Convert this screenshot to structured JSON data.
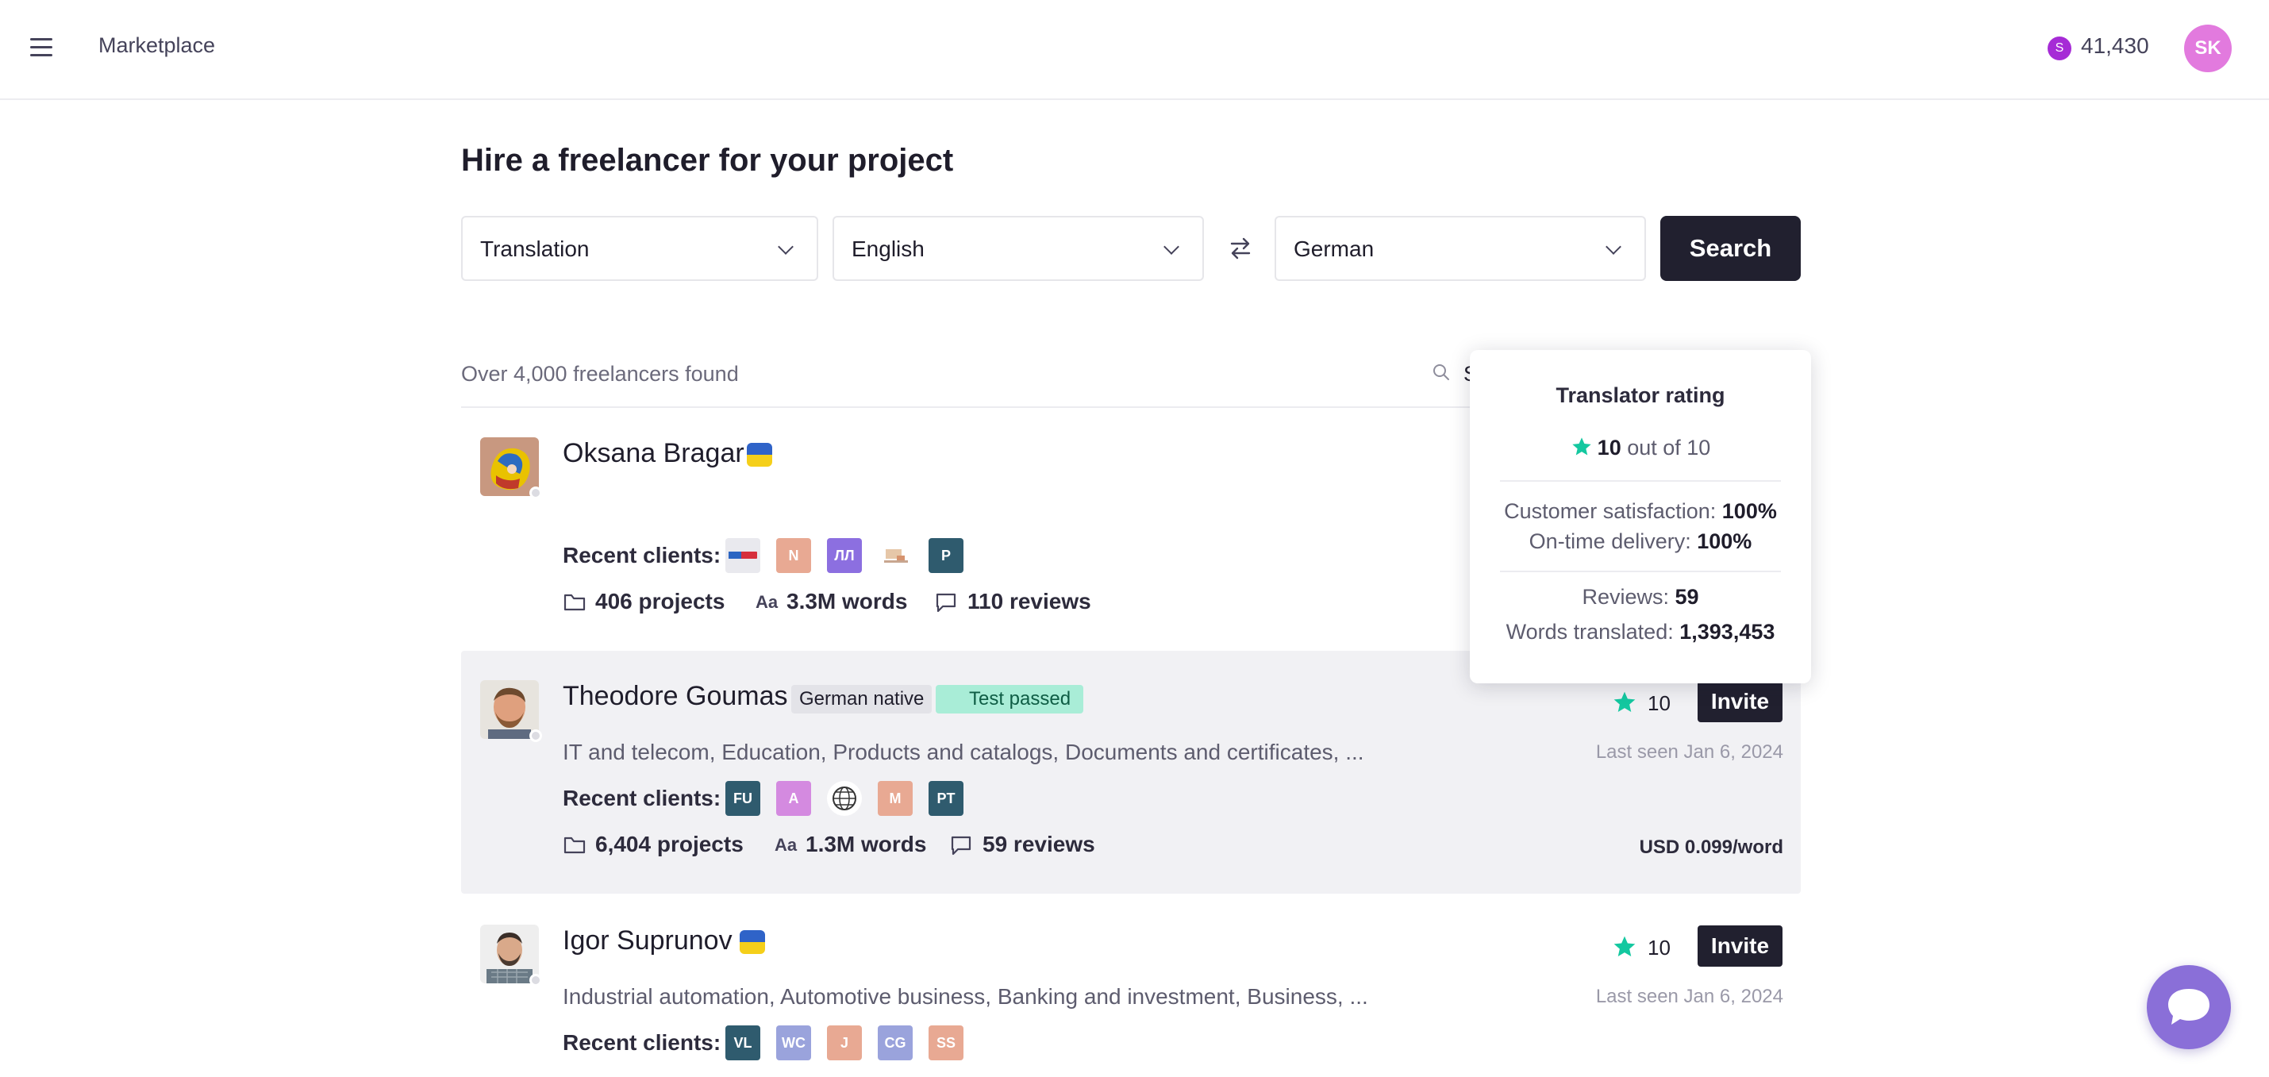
{
  "header": {
    "title": "Marketplace",
    "balance": "41,430",
    "coin_symbol": "S",
    "user_initials": "SK"
  },
  "page_title": "Hire a freelancer for your project",
  "search": {
    "service": "Translation",
    "source_language": "English",
    "target_language": "German",
    "button_label": "Search"
  },
  "results": {
    "count_text": "Over 4,000 freelancers found",
    "search_label": "S"
  },
  "freelancers": [
    {
      "name": "Oksana Bragar",
      "flag": "ua",
      "clients_label": "Recent clients:",
      "clients": [
        "",
        "N",
        "ЛЛ",
        "",
        "P"
      ],
      "projects": "406 projects",
      "words": "3.3M words",
      "reviews": "110 reviews"
    },
    {
      "name": "Theodore Goumas",
      "badge_native": "German native",
      "badge_test": "Test passed",
      "specializations": "IT and telecom, Education, Products and catalogs, Documents and certificates, ...",
      "clients_label": "Recent clients:",
      "clients": [
        "FU",
        "A",
        "",
        "M",
        "PT"
      ],
      "projects": "6,404 projects",
      "words": "1.3M words",
      "reviews": "59 reviews",
      "rating": "10",
      "invite": "Invite",
      "last_seen": "Last seen Jan 6, 2024",
      "rate": "USD 0.099/word"
    },
    {
      "name": "Igor Suprunov",
      "flag": "ua",
      "specializations": "Industrial automation, Automotive business, Banking and investment, Business, ...",
      "clients_label": "Recent clients:",
      "clients": [
        "VL",
        "WC",
        "J",
        "CG",
        "SS"
      ],
      "rating": "10",
      "invite": "Invite",
      "last_seen": "Last seen Jan 6, 2024"
    }
  ],
  "words_icon": "Aa",
  "popover": {
    "title": "Translator rating",
    "score": "10",
    "score_suffix": "out of 10",
    "satisfaction_label": "Customer satisfaction:",
    "satisfaction_value": "100%",
    "ontime_label": "On-time delivery:",
    "ontime_value": "100%",
    "reviews_label": "Reviews:",
    "reviews_value": "59",
    "words_label": "Words translated:",
    "words_value": "1,393,453"
  },
  "colors": {
    "accent_dark": "#21202f",
    "star": "#14c8a0",
    "chat": "#8a6fd8"
  }
}
